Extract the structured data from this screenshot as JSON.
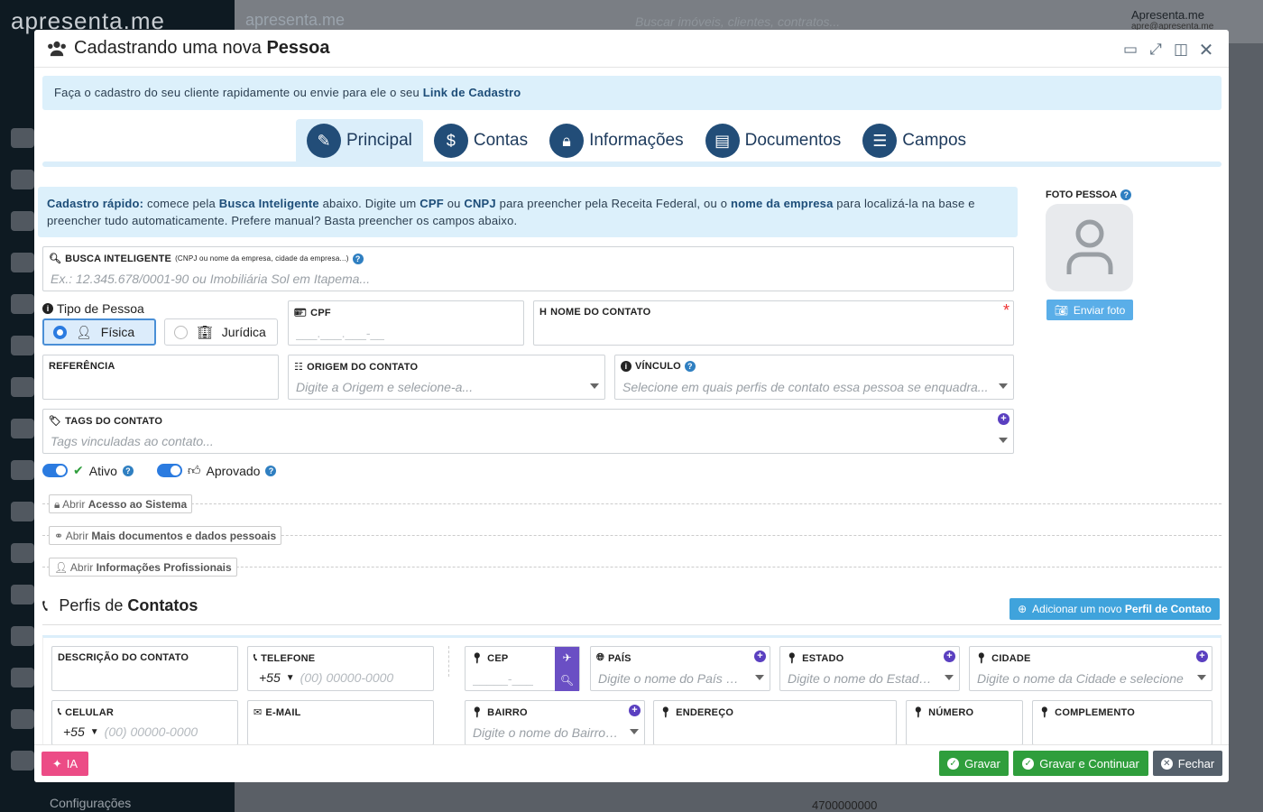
{
  "background": {
    "logo": "apresenta.me",
    "search_placeholder": "Buscar imóveis, clientes, contratos...",
    "user_name": "Apresenta.me",
    "user_email": "apre@apresenta.me",
    "sidebar_bottom": "Configurações",
    "phone_row": "4700000000"
  },
  "modal": {
    "title_prefix": "Cadastrando uma nova ",
    "title_bold": "Pessoa"
  },
  "banner": {
    "text": "Faça o cadastro do seu cliente rapidamente ou envie para ele o seu ",
    "link": "Link de Cadastro"
  },
  "tabs": [
    {
      "label": "Principal",
      "icon": "pencil-icon"
    },
    {
      "label": "Contas",
      "icon": "piggy-bank-icon"
    },
    {
      "label": "Informações",
      "icon": "lock-icon"
    },
    {
      "label": "Documentos",
      "icon": "document-icon"
    },
    {
      "label": "Campos",
      "icon": "list-plus-icon"
    }
  ],
  "quick": {
    "b1": "Cadastro rápido:",
    "t1": " comece pela ",
    "b2": "Busca Inteligente",
    "t2": " abaixo. Digite um ",
    "b3": "CPF",
    "t3": " ou ",
    "b4": "CNPJ",
    "t4": " para preencher pela Receita Federal, ou o ",
    "b5": "nome da empresa",
    "t5": " para localizá-la na base e preencher tudo automaticamente. Prefere manual? Basta preencher os campos abaixo."
  },
  "busca": {
    "label": "BUSCA INTELIGENTE",
    "hint": "(CNPJ ou nome da empresa, cidade da empresa...)",
    "placeholder": "Ex.: 12.345.678/0001-90 ou Imobiliária Sol em Itapema..."
  },
  "tipo": {
    "label": "Tipo de Pessoa",
    "fisica": "Física",
    "juridica": "Jurídica"
  },
  "cpf": {
    "label": "CPF",
    "mask": "___.___.___-__"
  },
  "nome": {
    "label": "NOME DO CONTATO",
    "required": "*"
  },
  "referencia": {
    "label": "REFERÊNCIA"
  },
  "origem": {
    "label": "ORIGEM DO CONTATO",
    "placeholder": "Digite a Origem e selecione-a..."
  },
  "vinculo": {
    "label": "VÍNCULO",
    "placeholder": "Selecione em quais perfis de contato essa pessoa se enquadra..."
  },
  "tags": {
    "label": "TAGS DO CONTATO",
    "placeholder": "Tags vinculadas ao contato..."
  },
  "toggles": {
    "ativo": "Ativo",
    "aprovado": "Aprovado"
  },
  "collapses": [
    {
      "pre": "Abrir ",
      "bold": "Acesso ao Sistema"
    },
    {
      "pre": "Abrir ",
      "bold": "Mais documentos e dados pessoais"
    },
    {
      "pre": "Abrir ",
      "bold": "Informações Profissionais"
    }
  ],
  "foto": {
    "label": "FOTO PESSOA",
    "button": "Enviar foto"
  },
  "perfis": {
    "title_pre": "Perfis de ",
    "title_bold": "Contatos",
    "add_pre": "Adicionar um novo ",
    "add_bold": "Perfil de Contato"
  },
  "contact": {
    "descricao": "DESCRIÇÃO DO CONTATO",
    "telefone": "TELEFONE",
    "celular": "CELULAR",
    "email": "E-MAIL",
    "ddi": "+55",
    "phone_ph": "(00) 00000-0000"
  },
  "address": {
    "cep": "CEP",
    "cep_mask": "_____-___",
    "pais": "PAÍS",
    "pais_ph": "Digite o nome do País e selecione",
    "estado": "ESTADO",
    "estado_ph": "Digite o nome do Estado e selecione",
    "cidade": "CIDADE",
    "cidade_ph": "Digite o nome da Cidade e selecione",
    "bairro": "BAIRRO",
    "bairro_ph": "Digite o nome do Bairro e selecione",
    "endereco": "ENDEREÇO",
    "numero": "NÚMERO",
    "complemento": "COMPLEMENTO"
  },
  "footer": {
    "ia": "IA",
    "gravar": "Gravar",
    "gravar_continuar": "Gravar e Continuar",
    "fechar": "Fechar"
  },
  "colors": {
    "primary": "#224d78",
    "info_bg": "#dcf0fb",
    "green": "#2f9e3c",
    "pink": "#ec4c86",
    "purple": "#6a4fc4"
  }
}
